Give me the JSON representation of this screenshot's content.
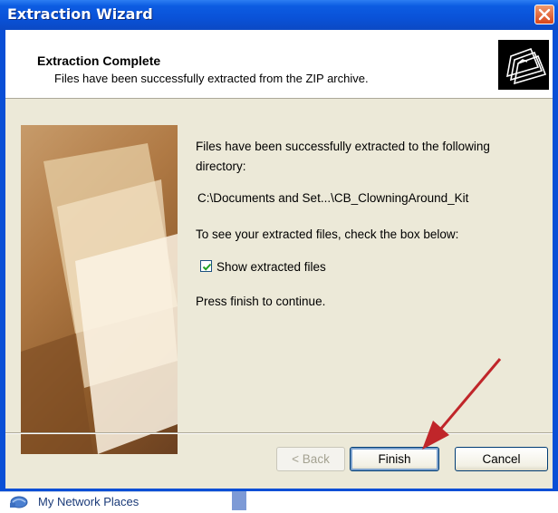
{
  "background": {
    "taskbar_item_label": "My Network Places",
    "taskbar_item_icon": "network-places-icon"
  },
  "window": {
    "title": "Extraction Wizard",
    "close_icon": "close-icon"
  },
  "header": {
    "title": "Extraction Complete",
    "subtitle": "Files have been successfully extracted from the ZIP archive.",
    "icon": "folders-icon"
  },
  "content": {
    "line1": "Files have been successfully extracted to the following",
    "line2": "directory:",
    "path": "C:\\Documents and Set...\\CB_ClowningAround_Kit",
    "instruction": "To see your extracted files, check the box below:",
    "checkbox_label": "Show extracted files",
    "checkbox_checked": true,
    "finish_prompt": "Press finish to continue."
  },
  "buttons": {
    "back": "< Back",
    "finish": "Finish",
    "cancel": "Cancel"
  },
  "colors": {
    "titlebar": "#0a52d8",
    "client": "#ece9d8",
    "annotation_arrow": "#c0262a"
  }
}
